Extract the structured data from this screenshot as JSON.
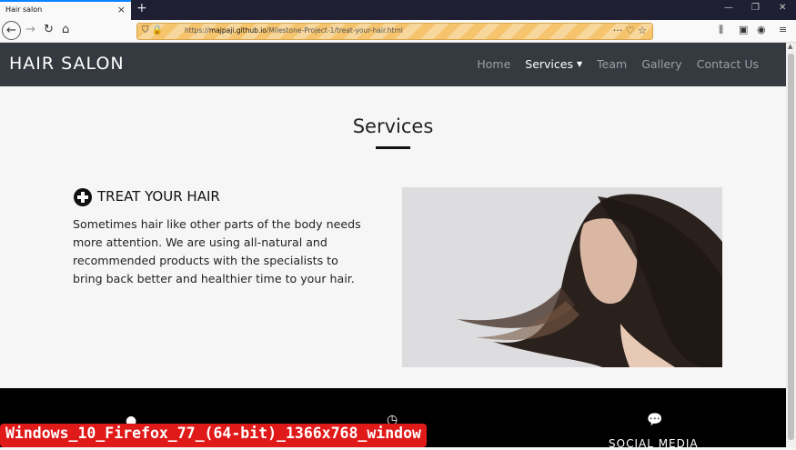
{
  "browser": {
    "tab_title": "Hair salon",
    "tab_close": "×",
    "new_tab": "+",
    "url_host": "majpaji.github.io",
    "url_prefix": "https://",
    "url_path": "/Milestone-Project-1/treat-your-hair.html",
    "window_controls": [
      "—",
      "❐",
      "✕"
    ]
  },
  "site": {
    "brand": "HAIR SALON",
    "menu": [
      {
        "label": "Home",
        "active": false
      },
      {
        "label": "Services",
        "active": true,
        "dropdown": true
      },
      {
        "label": "Team",
        "active": false
      },
      {
        "label": "Gallery",
        "active": false
      },
      {
        "label": "Contact Us",
        "active": false
      }
    ]
  },
  "content": {
    "section_title": "Services",
    "service_heading": "TREAT YOUR HAIR",
    "service_text": "Sometimes hair like other parts of the body needs more attention. We are using all-natural and recommended products with the specialists to bring back better and healthier time to your hair."
  },
  "footer": {
    "social_label": "SOCIAL MEDIA"
  },
  "watermark": "Windows_10_Firefox_77_(64-bit)_1366x768_window"
}
